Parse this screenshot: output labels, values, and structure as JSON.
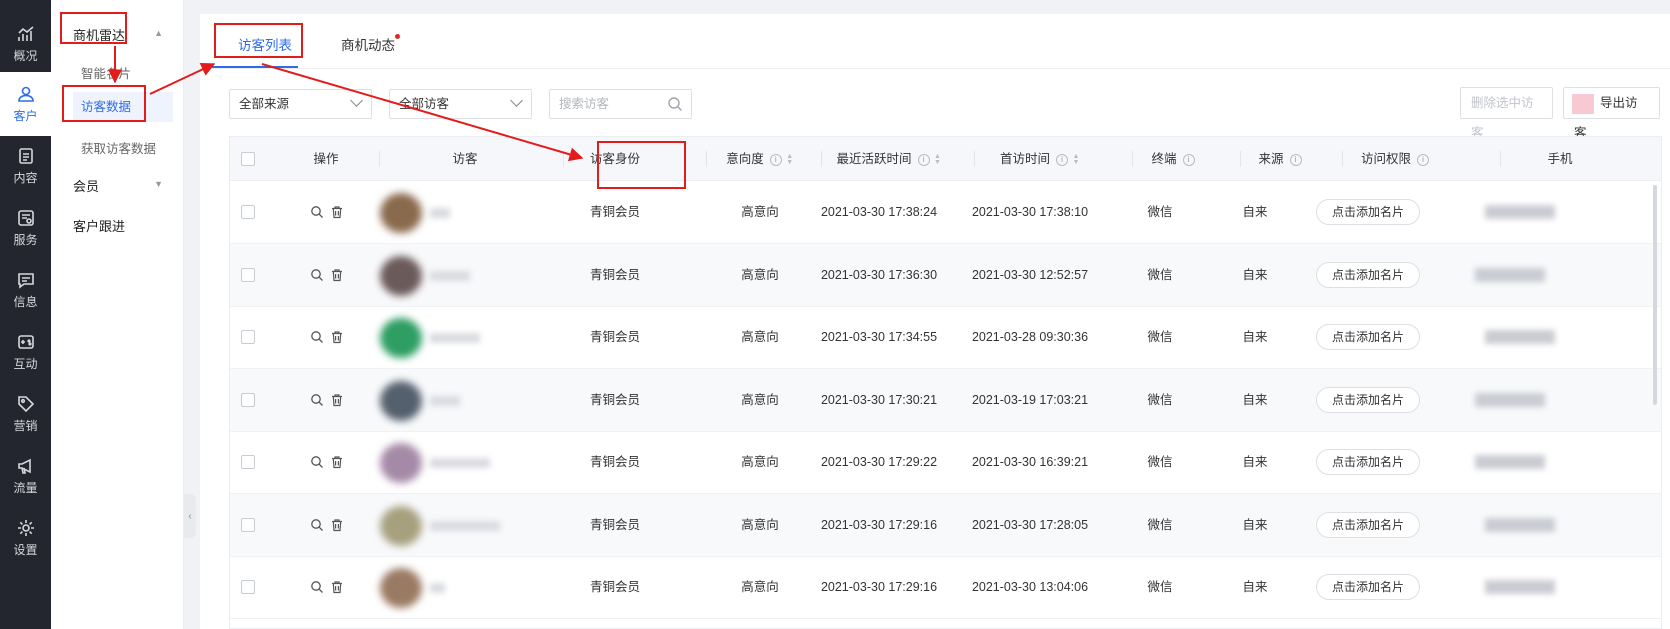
{
  "rail": {
    "items": [
      {
        "label": "概况",
        "icon": "chart-icon"
      },
      {
        "label": "客户",
        "icon": "user-icon"
      },
      {
        "label": "内容",
        "icon": "document-icon"
      },
      {
        "label": "服务",
        "icon": "service-icon"
      },
      {
        "label": "信息",
        "icon": "message-icon"
      },
      {
        "label": "互动",
        "icon": "interact-icon"
      },
      {
        "label": "营销",
        "icon": "tag-icon"
      },
      {
        "label": "流量",
        "icon": "megaphone-icon"
      },
      {
        "label": "设置",
        "icon": "gear-icon"
      }
    ],
    "active_color": "#2e6be6",
    "bg_color": "#23262e"
  },
  "subnav": {
    "group1": "商机雷达",
    "items": [
      "智能名片",
      "访客数据",
      "获取访客数据"
    ],
    "group2": "会员",
    "group3": "客户跟进"
  },
  "tabs": [
    "访客列表",
    "商机动态"
  ],
  "filters": {
    "source": "全部来源",
    "visitor": "全部访客",
    "search_placeholder": "搜索访客"
  },
  "buttons": {
    "delete": "删除选中访客",
    "export": "导出访客"
  },
  "table": {
    "headers": [
      "操作",
      "访客",
      "访客身份",
      "意向度",
      "最近活跃时间",
      "首访时间",
      "终端",
      "来源",
      "访问权限",
      "手机"
    ],
    "rows": [
      {
        "identity": "青铜会员",
        "intent": "高意向",
        "last_active": "2021-03-30 17:38:24",
        "first_visit": "2021-03-30 17:38:10",
        "terminal": "微信",
        "source": "自来",
        "action": "点击添加名片",
        "avatar_color": "#8a6a4c"
      },
      {
        "identity": "青铜会员",
        "intent": "高意向",
        "last_active": "2021-03-30 17:36:30",
        "first_visit": "2021-03-30 12:52:57",
        "terminal": "微信",
        "source": "自来",
        "action": "点击添加名片",
        "avatar_color": "#6b5a5a"
      },
      {
        "identity": "青铜会员",
        "intent": "高意向",
        "last_active": "2021-03-30 17:34:55",
        "first_visit": "2021-03-28 09:30:36",
        "terminal": "微信",
        "source": "自来",
        "action": "点击添加名片",
        "avatar_color": "#2e9e63"
      },
      {
        "identity": "青铜会员",
        "intent": "高意向",
        "last_active": "2021-03-30 17:30:21",
        "first_visit": "2021-03-19 17:03:21",
        "terminal": "微信",
        "source": "自来",
        "action": "点击添加名片",
        "avatar_color": "#55606e"
      },
      {
        "identity": "青铜会员",
        "intent": "高意向",
        "last_active": "2021-03-30 17:29:22",
        "first_visit": "2021-03-30 16:39:21",
        "terminal": "微信",
        "source": "自来",
        "action": "点击添加名片",
        "avatar_color": "#a58aa8"
      },
      {
        "identity": "青铜会员",
        "intent": "高意向",
        "last_active": "2021-03-30 17:29:16",
        "first_visit": "2021-03-30 17:28:05",
        "terminal": "微信",
        "source": "自来",
        "action": "点击添加名片",
        "avatar_color": "#a7a07e"
      },
      {
        "identity": "青铜会员",
        "intent": "高意向",
        "last_active": "2021-03-30 17:29:16",
        "first_visit": "2021-03-30 13:04:06",
        "terminal": "微信",
        "source": "自来",
        "action": "点击添加名片",
        "avatar_color": "#9a7a62"
      }
    ]
  },
  "annotation_color": "#e31b1b"
}
